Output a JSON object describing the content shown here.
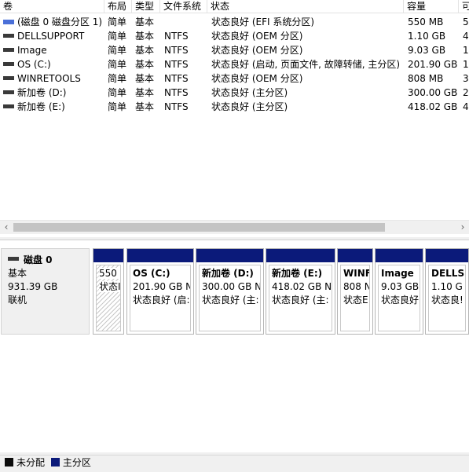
{
  "columns": {
    "volume": "卷",
    "layout": "布局",
    "type": "类型",
    "filesystem": "文件系统",
    "status": "状态",
    "capacity": "容量",
    "free": "可"
  },
  "volumes": [
    {
      "name": "(磁盘 0 磁盘分区 1)",
      "layout": "简单",
      "type": "基本",
      "fs": "",
      "status": "状态良好 (EFI 系统分区)",
      "capacity": "550 MB",
      "free": "5",
      "icon": "striped-volume-icon"
    },
    {
      "name": "DELLSUPPORT",
      "layout": "简单",
      "type": "基本",
      "fs": "NTFS",
      "status": "状态良好 (OEM 分区)",
      "capacity": "1.10 GB",
      "free": "4",
      "icon": "volume-icon"
    },
    {
      "name": "Image",
      "layout": "简单",
      "type": "基本",
      "fs": "NTFS",
      "status": "状态良好 (OEM 分区)",
      "capacity": "9.03 GB",
      "free": "1",
      "icon": "volume-icon"
    },
    {
      "name": "OS (C:)",
      "layout": "简单",
      "type": "基本",
      "fs": "NTFS",
      "status": "状态良好 (启动, 页面文件, 故障转储, 主分区)",
      "capacity": "201.90 GB",
      "free": "1",
      "icon": "volume-icon"
    },
    {
      "name": "WINRETOOLS",
      "layout": "简单",
      "type": "基本",
      "fs": "NTFS",
      "status": "状态良好 (OEM 分区)",
      "capacity": "808 MB",
      "free": "3",
      "icon": "volume-icon"
    },
    {
      "name": "新加卷 (D:)",
      "layout": "简单",
      "type": "基本",
      "fs": "NTFS",
      "status": "状态良好 (主分区)",
      "capacity": "300.00 GB",
      "free": "2",
      "icon": "volume-icon"
    },
    {
      "name": "新加卷 (E:)",
      "layout": "简单",
      "type": "基本",
      "fs": "NTFS",
      "status": "状态良好 (主分区)",
      "capacity": "418.02 GB",
      "free": "4",
      "icon": "volume-icon"
    }
  ],
  "scrollbar": {
    "left": "‹",
    "right": "›"
  },
  "disk": {
    "name": "磁盘 0",
    "type": "基本",
    "size": "931.39 GB",
    "state": "联机",
    "partitions": [
      {
        "label": "",
        "size": "550 I",
        "status": "状态I",
        "kind": "unallocated"
      },
      {
        "label": "OS  (C:)",
        "size": "201.90 GB N",
        "status": "状态良好 (启:",
        "kind": "primary"
      },
      {
        "label": "新加卷  (D:)",
        "size": "300.00 GB N",
        "status": "状态良好 (主:",
        "kind": "primary"
      },
      {
        "label": "新加卷  (E:)",
        "size": "418.02 GB N",
        "status": "状态良好 (主:",
        "kind": "primary"
      },
      {
        "label": "WINF",
        "size": "808 N",
        "status": "状态E",
        "kind": "primary"
      },
      {
        "label": "Image",
        "size": "9.03 GB",
        "status": "状态良好",
        "kind": "primary"
      },
      {
        "label": "DELLS",
        "size": "1.10 G",
        "status": "状态良!",
        "kind": "primary"
      }
    ]
  },
  "legend": {
    "unallocated": "未分配",
    "primary": "主分区"
  },
  "colors": {
    "primary": "#0b1a7a",
    "unallocated": "#0b0b0b",
    "efi_icon": "#4a6fd8"
  }
}
